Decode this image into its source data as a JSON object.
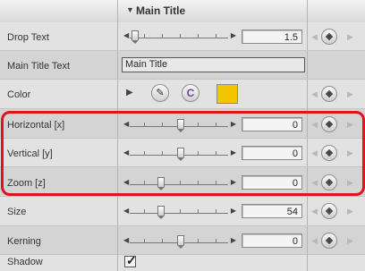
{
  "header": {
    "title": "Main Title",
    "disclosure_icon": "triangle-down-icon"
  },
  "rows": {
    "drop_text": {
      "label": "Drop Text",
      "value": "1.5"
    },
    "main_title_text": {
      "label": "Main Title Text",
      "value": "Main Title"
    },
    "color": {
      "label": "Color",
      "swatch": "#f5c400"
    },
    "horizontal": {
      "label": "Horizontal [x]",
      "value": "0"
    },
    "vertical": {
      "label": "Vertical [y]",
      "value": "0"
    },
    "zoom": {
      "label": "Zoom [z]",
      "value": "0"
    },
    "size": {
      "label": "Size",
      "value": "54"
    },
    "kerning": {
      "label": "Kerning",
      "value": "0"
    },
    "shadow": {
      "label": "Shadow",
      "checked": true
    }
  },
  "highlight_color": "#e0141b"
}
